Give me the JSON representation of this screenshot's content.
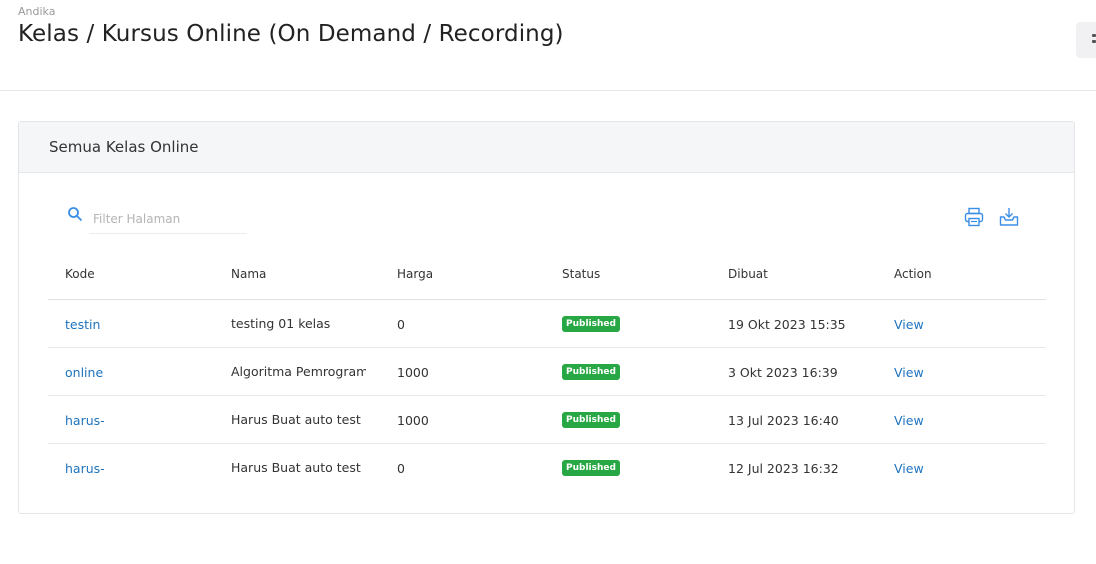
{
  "header": {
    "breadcrumb": "Andika",
    "title": "Kelas / Kursus Online (On Demand / Recording)"
  },
  "card": {
    "title": "Semua Kelas Online",
    "search": {
      "placeholder": "Filter Halaman",
      "value": ""
    },
    "icons": [
      "printer-icon",
      "download-tray-icon",
      "search-icon"
    ]
  },
  "table": {
    "headers": [
      "Kode",
      "Nama",
      "Harga",
      "Status",
      "Dibuat",
      "Action"
    ],
    "rows": [
      {
        "kode": "testin",
        "nama": "testing 01 kelas",
        "harga": "0",
        "status": "Published",
        "dibuat": "19 Okt 2023 15:35",
        "action": "View"
      },
      {
        "kode": "online",
        "nama": "Algoritma Pemrograman",
        "harga": "1000",
        "status": "Published",
        "dibuat": "3 Okt 2023 16:39",
        "action": "View"
      },
      {
        "kode": "harus-",
        "nama": "Harus Buat auto test",
        "harga": "1000",
        "status": "Published",
        "dibuat": "13 Jul 2023 16:40",
        "action": "View"
      },
      {
        "kode": "harus-",
        "nama": "Harus Buat auto test",
        "harga": "0",
        "status": "Published",
        "dibuat": "12 Jul 2023 16:32",
        "action": "View"
      }
    ]
  },
  "colors": {
    "link": "#1e73be",
    "badge": "#28a745",
    "icon_blue": "#3a8ee6"
  }
}
